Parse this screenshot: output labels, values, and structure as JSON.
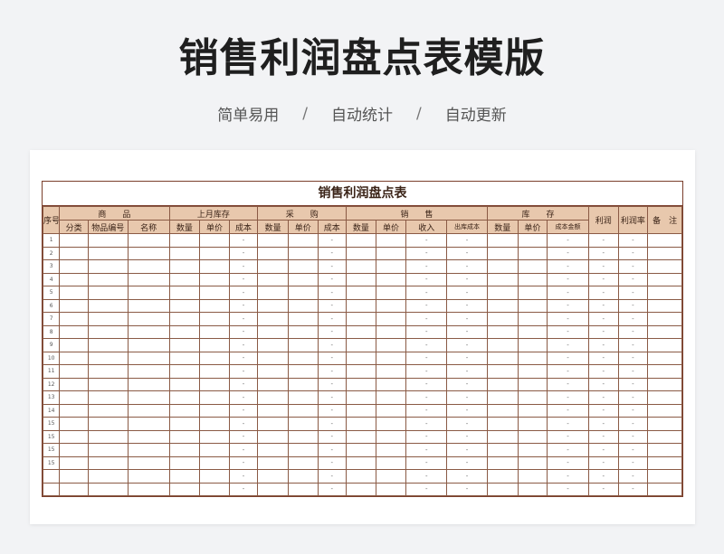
{
  "header": {
    "title": "销售利润盘点表模版",
    "features": [
      "简单易用",
      "自动统计",
      "自动更新"
    ],
    "separator": "/"
  },
  "sheet": {
    "title": "销售利润盘点表",
    "groups": {
      "seq": "序号",
      "goods": "商　　品",
      "last_month": "上月库存",
      "purchase": "采　　购",
      "sales": "销　　售",
      "stock": "库　　存",
      "profit": "利润",
      "profit_rate": "利润率",
      "remark": "备　注"
    },
    "subheaders": {
      "goods": [
        "分类",
        "物品编号",
        "名称"
      ],
      "last_month": [
        "数量",
        "单价",
        "成本"
      ],
      "purchase": [
        "数量",
        "单价",
        "成本"
      ],
      "sales": [
        "数量",
        "单价",
        "收入",
        "出库成本"
      ],
      "stock": [
        "数量",
        "单价",
        "成本金额"
      ]
    },
    "dash": "-",
    "rows": [
      "1",
      "2",
      "3",
      "4",
      "5",
      "6",
      "7",
      "8",
      "9",
      "10",
      "11",
      "12",
      "13",
      "14",
      "15",
      "15",
      "15",
      "15",
      "",
      ""
    ]
  }
}
